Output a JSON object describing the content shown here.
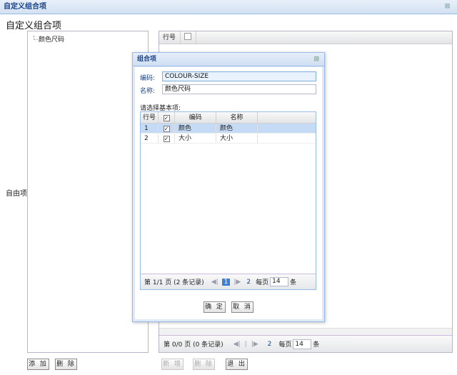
{
  "window": {
    "title": "自定义组合项",
    "close_glyph": "⊠"
  },
  "page": {
    "heading": "自定义组合项",
    "free_label": "自由项"
  },
  "tree": {
    "node_label": "颜色尺码"
  },
  "grid": {
    "header_rownum": "行号",
    "pager": {
      "page_text": "第  0/0 页  (0 条记录)",
      "page_number": "2",
      "per_page_label": "每页",
      "page_size": "14",
      "unit": "条"
    }
  },
  "left_buttons": {
    "add": "添 加",
    "delete": "删 除"
  },
  "right_buttons": {
    "new": "新 增",
    "delete": "删 除",
    "exit": "退 出"
  },
  "dialog": {
    "title": "组合项",
    "close_glyph": "⊠",
    "code_label": "编码:",
    "code_value": "COLOUR-SIZE",
    "name_label": "名称:",
    "name_value": "颜色尺码",
    "section_label": "请选择基本项:",
    "grid": {
      "headers": [
        "行号",
        "",
        "编码",
        "名称"
      ],
      "rows": [
        {
          "num": "1",
          "checked": true,
          "code": "颜色",
          "name": "颜色"
        },
        {
          "num": "2",
          "checked": true,
          "code": "大小",
          "name": "大小"
        }
      ],
      "pager": {
        "page_text": "第  1/1 页  (2 条记录)",
        "active_page": "1",
        "page_number": "2",
        "per_page_label": "每页",
        "page_size": "14",
        "unit": "条"
      }
    },
    "ok_label": "确 定",
    "cancel_label": "取 消"
  },
  "colors": {
    "title_blue": "#15428b",
    "selected_row": "#c5dbf5",
    "border_blue": "#99bbe8"
  }
}
